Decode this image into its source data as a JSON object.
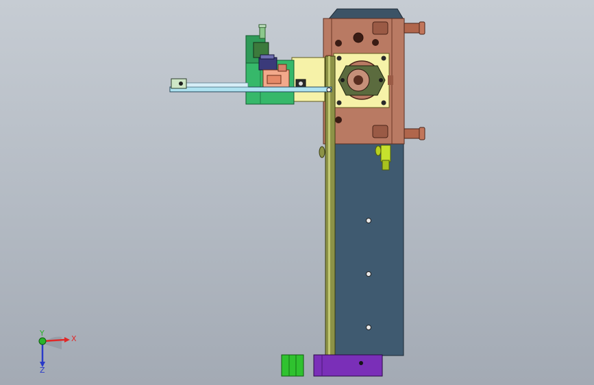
{
  "viewport": {
    "background_top": "#c6ccd3",
    "background_bottom": "#a3aab4"
  },
  "model": {
    "colors": {
      "manifold_block": "#b97a63",
      "manifold_dark": "#7a3f2e",
      "steel_plate": "#3f5a70",
      "rod": "#9aa050",
      "yellow_bracket": "#f6f2a8",
      "cyan_arm": "#aee3f1",
      "green_body": "#36b86a",
      "pink_part": "#f2a98b",
      "purple_foot": "#7a2fb8",
      "green_foot": "#2fc22f",
      "fitting_yellow": "#c6e22d",
      "navy_part": "#3a3a7a"
    }
  },
  "triad": {
    "x_label": "X",
    "y_label": "Y",
    "z_label": "Z",
    "x_color": "#e02828",
    "y_color": "#2bb32b",
    "z_color": "#2a3ac8"
  }
}
